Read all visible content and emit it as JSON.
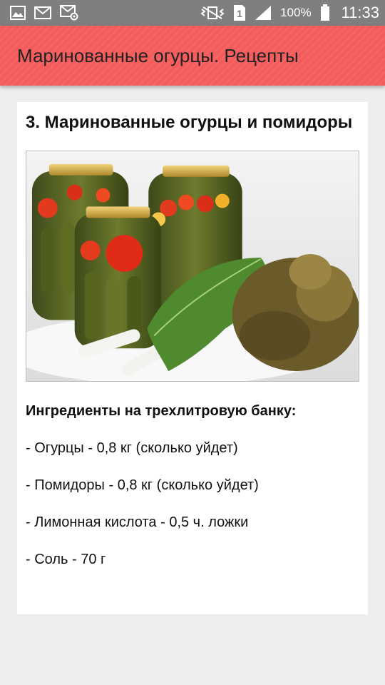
{
  "status_bar": {
    "icons_left": [
      "gallery-icon",
      "mail-icon",
      "mail-settings-icon"
    ],
    "icons_right": [
      "vibrate-icon",
      "sim-1-icon",
      "signal-icon",
      "battery-icon"
    ],
    "sim_label": "1",
    "battery": "100%",
    "time": "11:33"
  },
  "app_bar": {
    "title": "Маринованные огурцы. Рецепты",
    "color": "#f45b5b"
  },
  "recipe": {
    "title": "3. Маринованные огурцы и помидоры",
    "image": "pickled-cucumbers-tomatoes-jars-photo",
    "ingredients_heading": "Ингредиенты на трехлитровую банку:",
    "ingredients": [
      "- Огурцы - 0,8 кг (сколько уйдет)",
      "- Помидоры - 0,8 кг (сколько уйдет)",
      "- Лимонная кислота - 0,5 ч. ложки",
      "- Соль - 70 г"
    ]
  }
}
